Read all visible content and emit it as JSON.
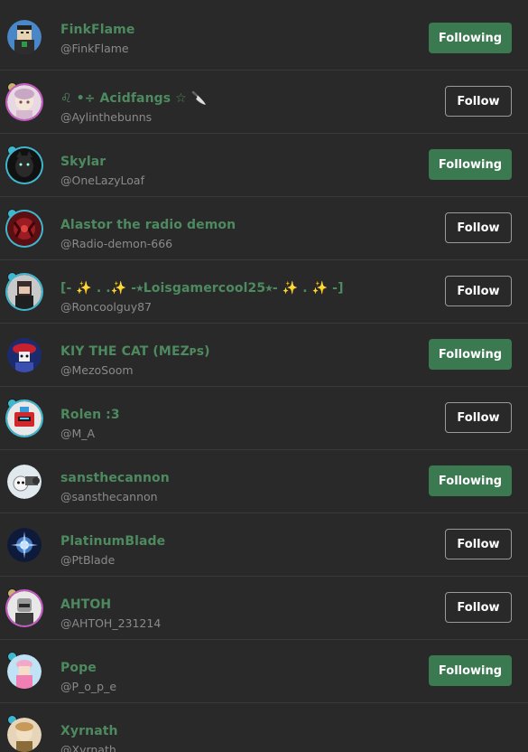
{
  "users": [
    {
      "name": "FinkFlame",
      "handle": "@FinkFlame",
      "button": "Following",
      "status": "following"
    },
    {
      "name": "♌ •÷ Acidfangs ☆ 🔪",
      "handle": "@Aylinthebunns",
      "button": "Follow",
      "status": "follow"
    },
    {
      "name": "Skylar",
      "handle": "@OneLazyLoaf",
      "button": "Following",
      "status": "following"
    },
    {
      "name": "Alastor the radio demon",
      "handle": "@Radio-demon-666",
      "button": "Follow",
      "status": "follow"
    },
    {
      "name": "[- ✨ . .✨ -⭑Loisgamercool25⭑- ✨ . ✨ -]",
      "handle": "@Roncoolguy87",
      "button": "Follow",
      "status": "follow"
    },
    {
      "name": "KIY THE CAT (MEZᴘs)",
      "handle": "@MezoSoom",
      "button": "Following",
      "status": "following"
    },
    {
      "name": "Rolen :3",
      "handle": "@M_A",
      "button": "Follow",
      "status": "follow"
    },
    {
      "name": "sansthecannon",
      "handle": "@sansthecannon",
      "button": "Following",
      "status": "following"
    },
    {
      "name": "PlatinumBlade",
      "handle": "@PtBlade",
      "button": "Follow",
      "status": "follow"
    },
    {
      "name": "AHTOH",
      "handle": "@AHTOH_231214",
      "button": "Follow",
      "status": "follow"
    },
    {
      "name": "Pope",
      "handle": "@P_o_p_e",
      "button": "Following",
      "status": "following"
    },
    {
      "name": "Xyrnath",
      "handle": "@Xyrnath",
      "button": "",
      "status": "none"
    }
  ],
  "colors": {
    "background": "#292929",
    "name": "#4d8a5f",
    "handle": "#8a8a8a",
    "following_button": "#3b7a51",
    "follow_border": "#9a9a9a"
  }
}
